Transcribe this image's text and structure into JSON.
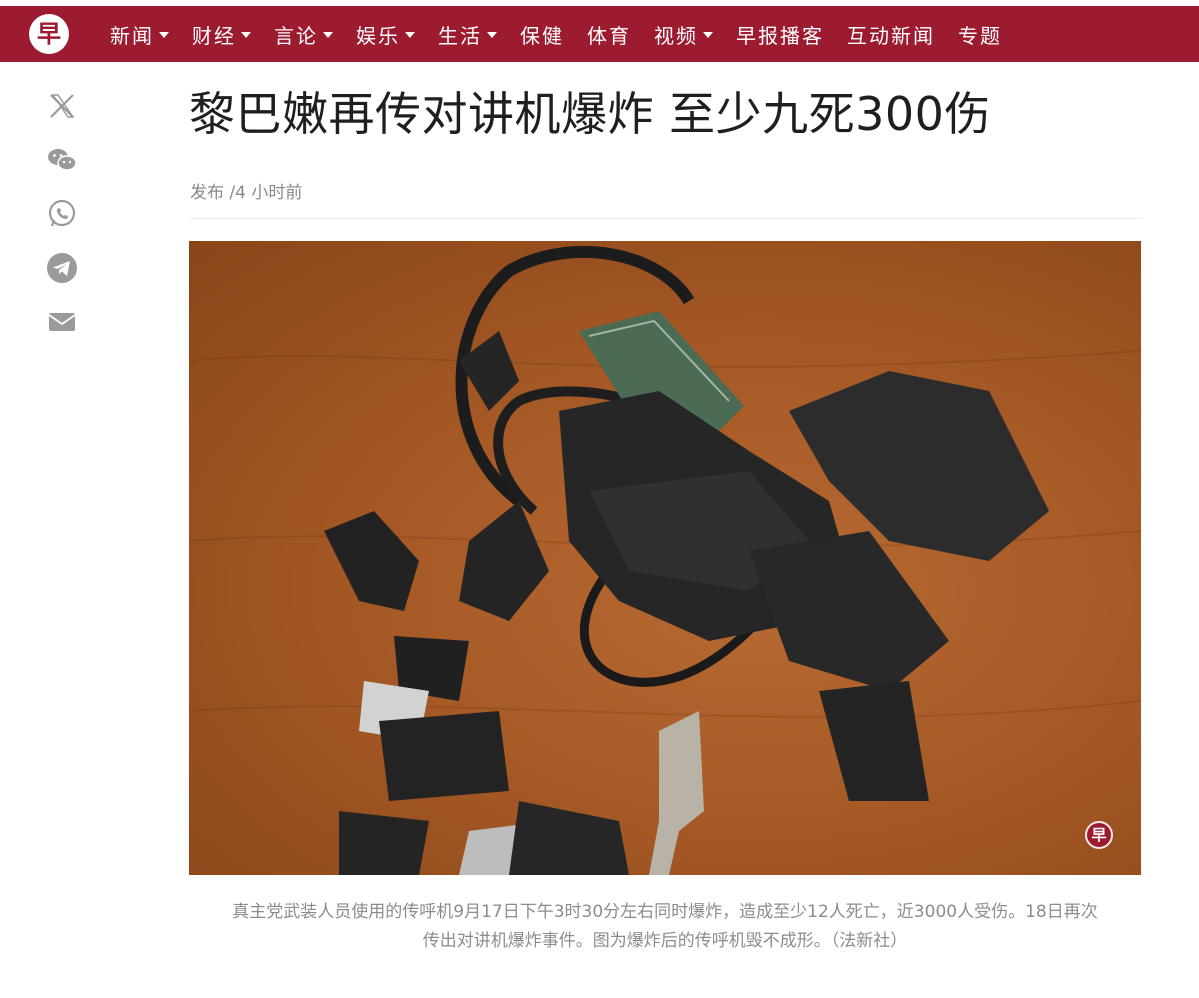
{
  "header": {
    "logo_text": "早",
    "nav_items": [
      {
        "label": "新闻",
        "dropdown": true
      },
      {
        "label": "财经",
        "dropdown": true
      },
      {
        "label": "言论",
        "dropdown": true
      },
      {
        "label": "娱乐",
        "dropdown": true
      },
      {
        "label": "生活",
        "dropdown": true
      },
      {
        "label": "保健",
        "dropdown": false
      },
      {
        "label": "体育",
        "dropdown": false
      },
      {
        "label": "视频",
        "dropdown": true
      },
      {
        "label": "早报播客",
        "dropdown": false
      },
      {
        "label": "互动新闻",
        "dropdown": false
      },
      {
        "label": "专题",
        "dropdown": false
      }
    ],
    "brand_color": "#9c1b30"
  },
  "share": {
    "icons": [
      "x-icon",
      "wechat-icon",
      "whatsapp-icon",
      "telegram-icon",
      "email-icon"
    ]
  },
  "article": {
    "headline": "黎巴嫩再传对讲机爆炸 至少九死300伤",
    "byline": "发布 /4 小时前",
    "photo": {
      "description_icon": "photo-exploded-pager-debris",
      "watermark_text": "早"
    },
    "caption_line1": "真主党武装人员使用的传呼机9月17日下午3时30分左右同时爆炸，造成至少12人死亡，近3000人受伤。18日再次",
    "caption_line2": "传出对讲机爆炸事件。图为爆炸后的传呼机毁不成形。（法新社）"
  }
}
